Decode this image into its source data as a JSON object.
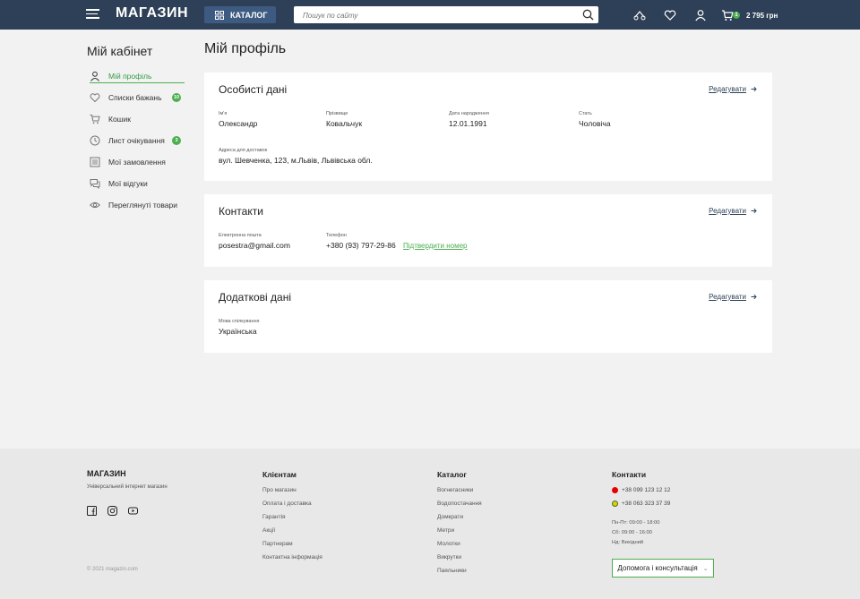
{
  "header": {
    "logo": "МАГАЗИН",
    "catalog_label": "КАТАЛОГ",
    "search_placeholder": "Пошук по сайту",
    "cart_count": "1",
    "cart_total": "2 795 грн"
  },
  "sidebar": {
    "title": "Мій кабінет",
    "items": [
      {
        "label": "Мій профіль",
        "icon": "user-icon",
        "badge": ""
      },
      {
        "label": "Списки бажань",
        "icon": "heart-icon",
        "badge": "10"
      },
      {
        "label": "Кошик",
        "icon": "cart-icon",
        "badge": ""
      },
      {
        "label": "Лист очікування",
        "icon": "clock-icon",
        "badge": "3"
      },
      {
        "label": "Мої замовлення",
        "icon": "orders-icon",
        "badge": ""
      },
      {
        "label": "Мої відгуки",
        "icon": "reviews-icon",
        "badge": ""
      },
      {
        "label": "Переглянуті товари",
        "icon": "eye-icon",
        "badge": ""
      }
    ]
  },
  "main": {
    "title": "Мій профіль",
    "edit_label": "Редагувати",
    "personal": {
      "title": "Особисті дані",
      "first_name_label": "Ім'я",
      "first_name": "Олександр",
      "last_name_label": "Прізвище",
      "last_name": "Ковальчук",
      "birth_label": "Дата народження",
      "birth": "12.01.1991",
      "gender_label": "Стать",
      "gender": "Чоловіча",
      "address_label": "Адреса для доставок",
      "address": "вул. Шевченка, 123, м.Львів, Львівська обл."
    },
    "contacts": {
      "title": "Контакти",
      "email_label": "Електронна пошта",
      "email": "posestra@gmail.com",
      "phone_label": "Телефон",
      "phone": "+380 (93) 797-29-86",
      "confirm_label": "Підтвердити номер"
    },
    "extra": {
      "title": "Додаткові дані",
      "lang_label": "Мова спілкування",
      "lang": "Українська"
    }
  },
  "footer": {
    "brand": "МАГАЗИН",
    "brand_sub": "Універсальний інтернет магазин",
    "copyright": "© 2021 magazin.com",
    "clients_title": "Клієнтам",
    "clients": [
      "Про магазин",
      "Оплата і доставка",
      "Гарантія",
      "Акції",
      "Партнерам",
      "Контактна інформація"
    ],
    "catalog_title": "Каталог",
    "catalog": [
      "Вогнегасники",
      "Водопостачання",
      "Домкрати",
      "Метри",
      "Молотки",
      "Викрутки",
      "Паяльники"
    ],
    "contacts_title": "Контакти",
    "phone1": "+38 099 123 12 12",
    "phone2": "+38 063 323 37 39",
    "hours1": "Пн-Пт: 09:00 - 18:00",
    "hours2": "Сб: 09:00 - 16:00",
    "hours3": "Нд: Вихідний",
    "help_label": "Допомога і консультація",
    "colors": {
      "vodafone": "#e60000",
      "lifecell": "#f5c400",
      "accent": "#4caf50",
      "header": "#2e4057"
    }
  }
}
